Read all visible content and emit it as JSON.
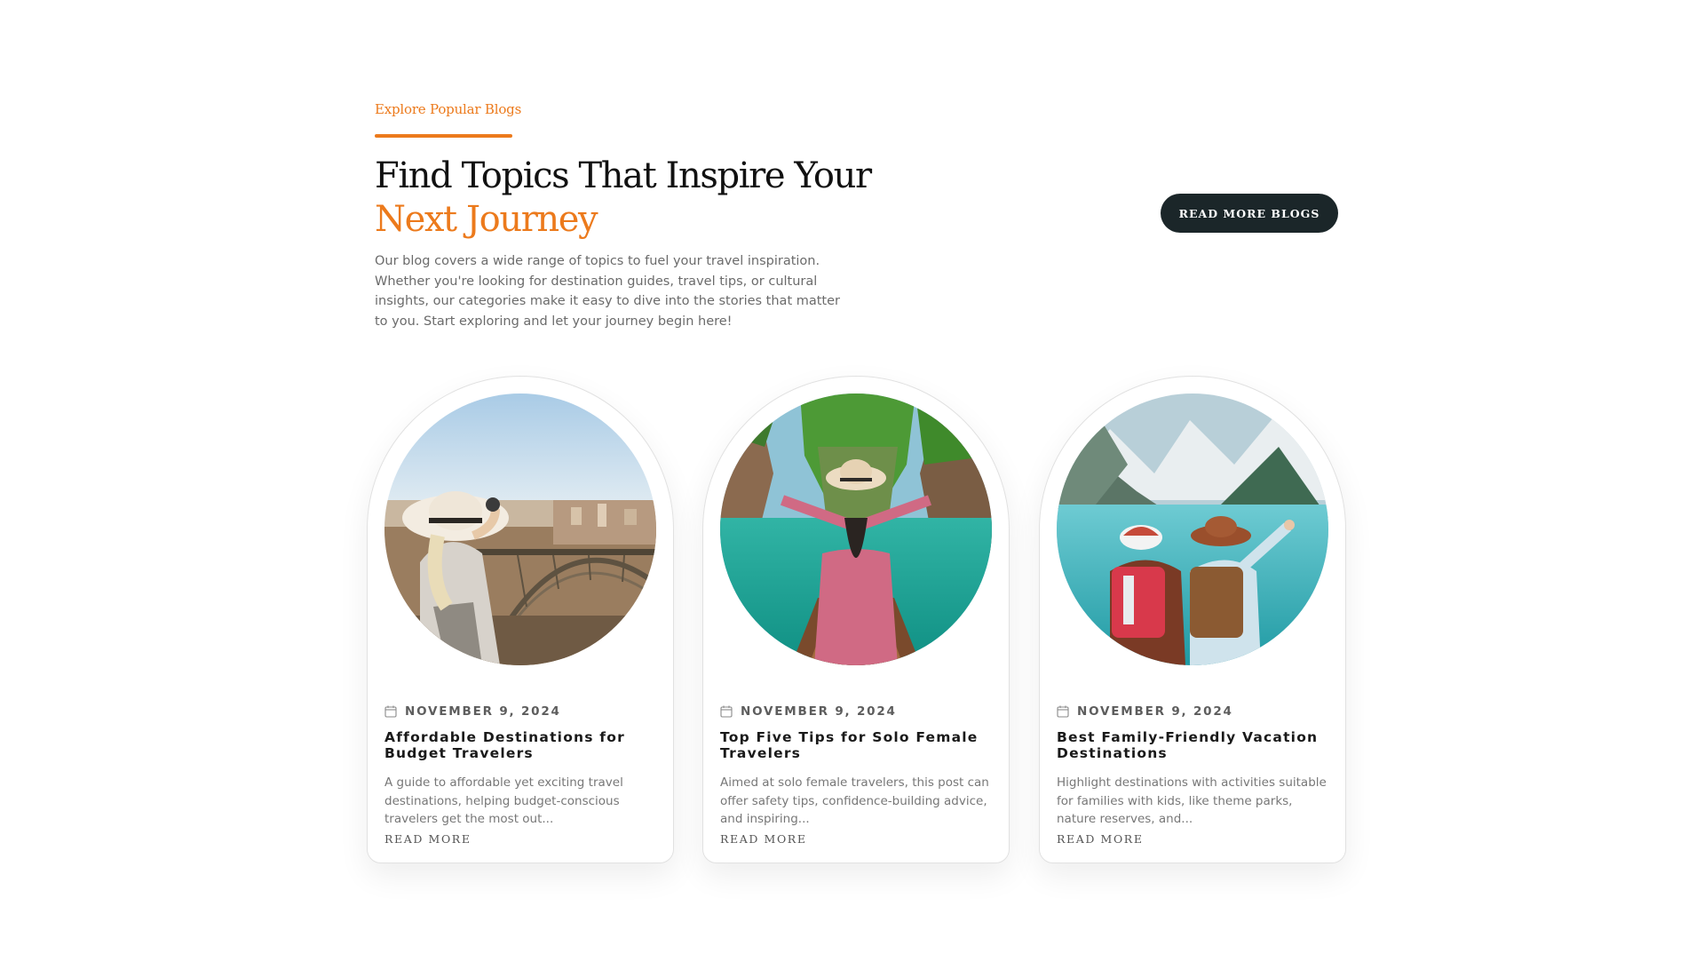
{
  "header": {
    "eyebrow": "Explore Popular Blogs",
    "title_line1": "Find Topics That Inspire Your",
    "title_line2": "Next Journey",
    "intro": "Our blog covers a wide range of topics to fuel your travel inspiration. Whether you're looking for destination guides, travel tips, or cultural insights, our categories make it easy to dive into the stories that matter to you. Start exploring and let your journey begin here!",
    "cta_label": "READ MORE BLOGS"
  },
  "colors": {
    "accent": "#ec7a1c",
    "button_bg": "#1b2629",
    "text_dark": "#111111",
    "text_muted": "#6b6b6b"
  },
  "cards": [
    {
      "image": "woman-with-hat-overlooking-bridge-city",
      "icon": "calendar-icon",
      "date": "NOVEMBER 9, 2024",
      "title": "Affordable Destinations for Budget Travelers",
      "excerpt": "A guide to affordable yet exciting travel destinations, helping budget-conscious travelers get the most out...",
      "link_label": "READ MORE"
    },
    {
      "image": "woman-in-pink-dress-on-boat-lagoon",
      "icon": "calendar-icon",
      "date": "NOVEMBER 9, 2024",
      "title": "Top Five Tips for Solo Female Travelers",
      "excerpt": "Aimed at solo female travelers, this post can offer safety tips, confidence-building advice, and inspiring...",
      "link_label": "READ MORE"
    },
    {
      "image": "couple-with-backpacks-at-mountain-lake",
      "icon": "calendar-icon",
      "date": "NOVEMBER 9, 2024",
      "title": "Best Family-Friendly Vacation Destinations",
      "excerpt": "Highlight destinations with activities suitable for families with kids, like theme parks, nature reserves, and...",
      "link_label": "READ MORE"
    }
  ]
}
